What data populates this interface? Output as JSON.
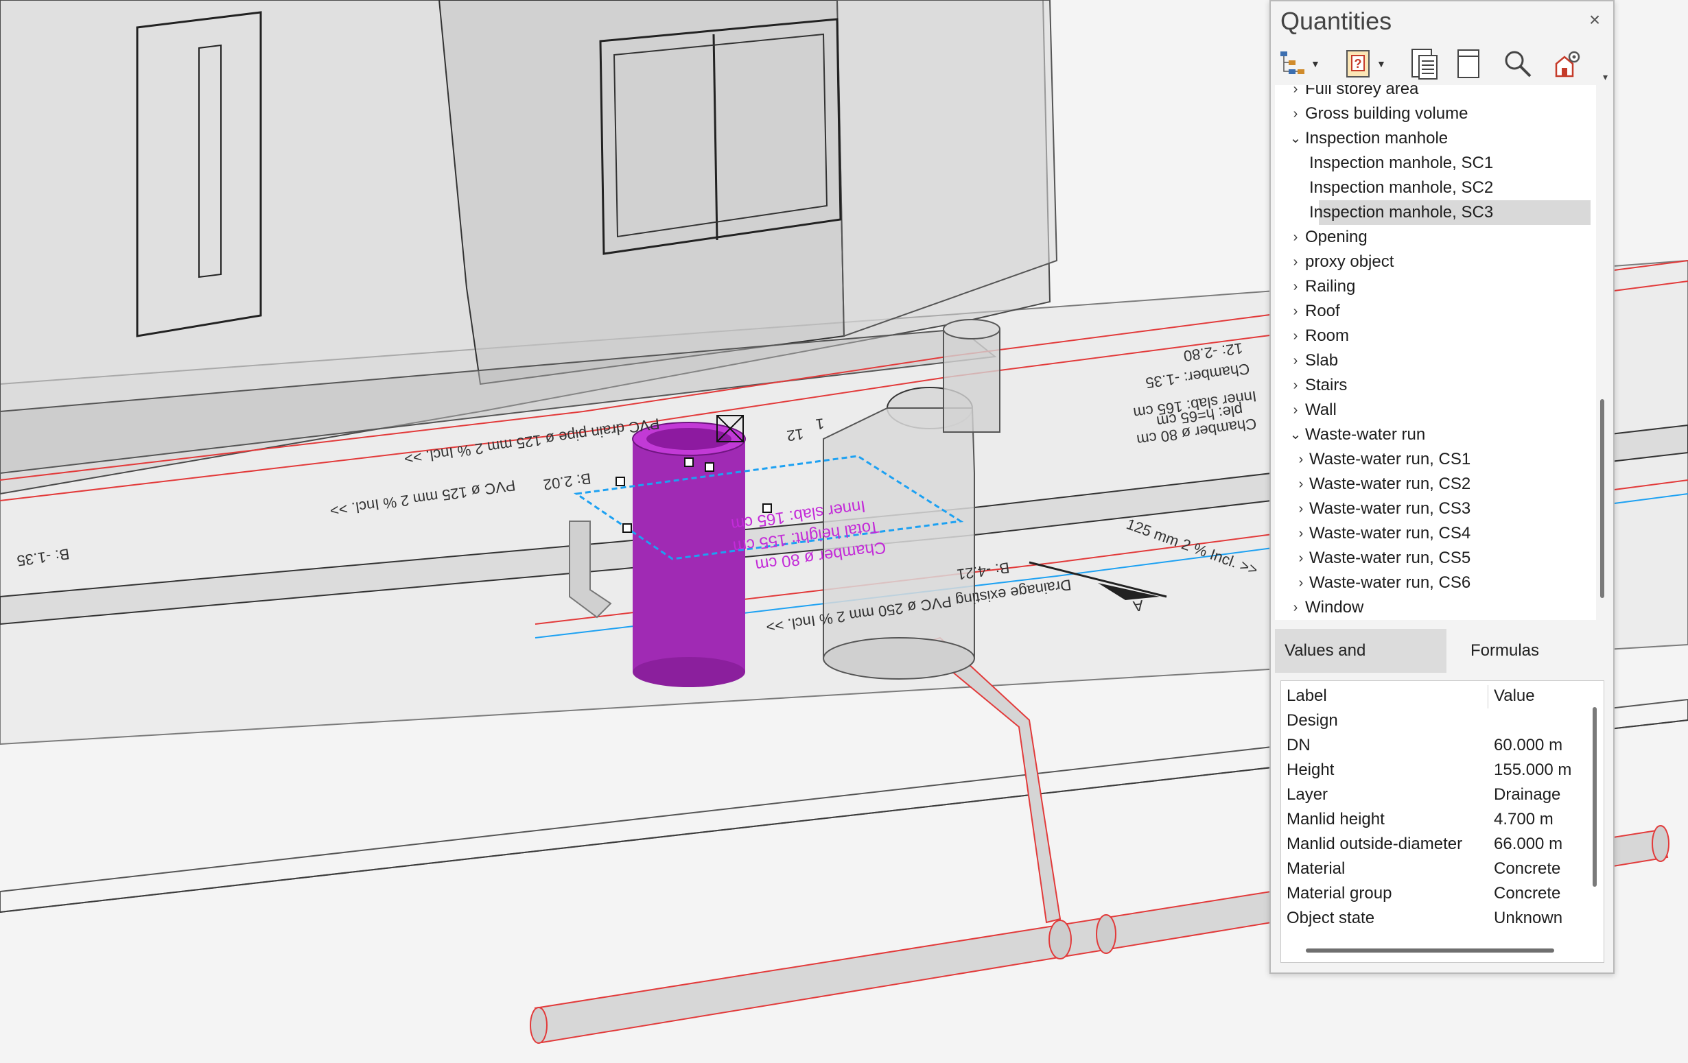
{
  "panel": {
    "title": "Quantities",
    "close_symbol": "×",
    "toolbar": [
      "tree-structure-icon",
      "help-report-icon",
      "list-report-icon",
      "single-page-icon",
      "search-icon",
      "settings-icon"
    ],
    "tree": [
      {
        "label": "Full storey area",
        "level": 0,
        "expanded": false
      },
      {
        "label": "Gross building volume",
        "level": 0,
        "expanded": false
      },
      {
        "label": "Inspection manhole",
        "level": 0,
        "expanded": true
      },
      {
        "label": "Inspection manhole, SC1",
        "level": 1,
        "leaf": true
      },
      {
        "label": "Inspection manhole, SC2",
        "level": 1,
        "leaf": true
      },
      {
        "label": "Inspection manhole, SC3",
        "level": 1,
        "leaf": true,
        "selected": true
      },
      {
        "label": "Opening",
        "level": 0,
        "expanded": false
      },
      {
        "label": "proxy object",
        "level": 0,
        "expanded": false
      },
      {
        "label": "Railing",
        "level": 0,
        "expanded": false
      },
      {
        "label": "Roof",
        "level": 0,
        "expanded": false
      },
      {
        "label": "Room",
        "level": 0,
        "expanded": false
      },
      {
        "label": "Slab",
        "level": 0,
        "expanded": false
      },
      {
        "label": "Stairs",
        "level": 0,
        "expanded": false
      },
      {
        "label": "Wall",
        "level": 0,
        "expanded": false
      },
      {
        "label": "Waste-water run",
        "level": 0,
        "expanded": true
      },
      {
        "label": "Waste-water run, CS1",
        "level": 1,
        "expanded": false
      },
      {
        "label": "Waste-water run, CS2",
        "level": 1,
        "expanded": false
      },
      {
        "label": "Waste-water run, CS3",
        "level": 1,
        "expanded": false
      },
      {
        "label": "Waste-water run, CS4",
        "level": 1,
        "expanded": false
      },
      {
        "label": "Waste-water run, CS5",
        "level": 1,
        "expanded": false
      },
      {
        "label": "Waste-water run, CS6",
        "level": 1,
        "expanded": false
      },
      {
        "label": "Window",
        "level": 0,
        "expanded": false
      }
    ],
    "tabs": [
      {
        "label": "Values and attributes",
        "active": true
      },
      {
        "label": "Formulas",
        "active": false
      }
    ],
    "table": {
      "headers": [
        "Label",
        "Value"
      ],
      "rows": [
        [
          "Design",
          ""
        ],
        [
          "DN",
          "60.000 m"
        ],
        [
          "Height",
          "155.000 m"
        ],
        [
          "Layer",
          "Drainage"
        ],
        [
          "Manlid height",
          "4.700 m"
        ],
        [
          "Manlid outside-diameter",
          "66.000 m"
        ],
        [
          "Material",
          "Concrete"
        ],
        [
          "Material group",
          "Concrete"
        ],
        [
          "Object state",
          "Unknown"
        ]
      ]
    }
  },
  "viewport": {
    "annotations": [
      "PVC ø 125 mm 2 % Incl. >>",
      "PVC drain pipe ø 125 mm 2 % Incl. >>",
      "Drainage existing PVC ø 250 mm 2 % Incl. >>",
      "125 mm 2 % Incl. >>",
      "B: -1.35",
      "B: 2.02",
      "B: -4.21",
      "Inner slab: 165 cm",
      "Chamber ø 80 cm",
      "Chamber: -1.35",
      "12: -2.80",
      "ple: h=65 cm",
      "Inner slab: 165 cm",
      "Total height: 155 cm",
      "Chamber ø 80 cm",
      "A",
      "1",
      "12"
    ],
    "colors": {
      "selection": "#9a1fb3",
      "pipe_outline": "#e23a3a",
      "selection_frame": "#1da1f2",
      "background": "#f4f4f4"
    }
  }
}
